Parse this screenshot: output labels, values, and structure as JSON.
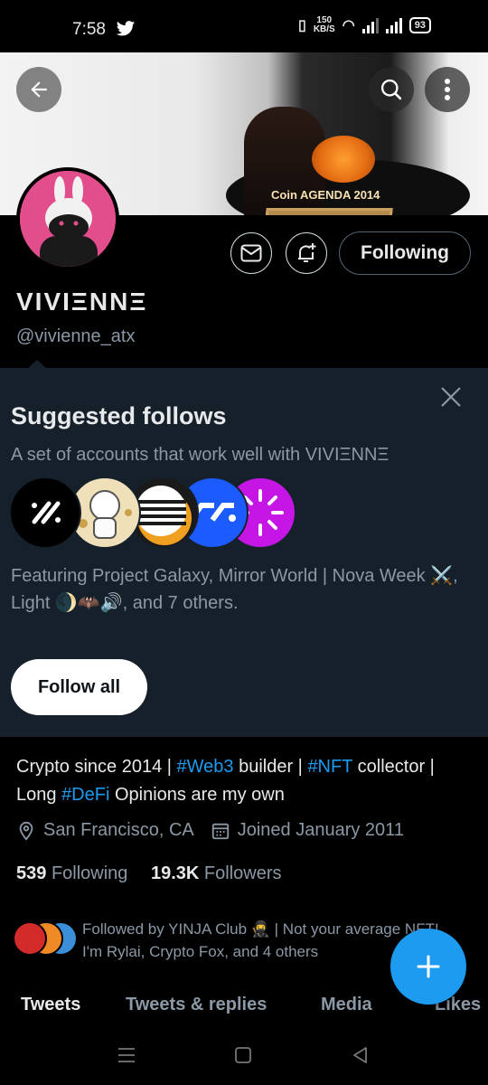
{
  "status_bar": {
    "time": "7:58",
    "net_speed": "150",
    "net_unit": "KB/S",
    "battery": "93"
  },
  "banner": {
    "caption": "Coin AGENDA 2014"
  },
  "profile": {
    "display_name": "VIVIΞNNΞ",
    "handle": "@vivienne_atx",
    "following_button": "Following"
  },
  "suggested": {
    "title": "Suggested follows",
    "subtitle": "A set of accounts that work well with VIVIΞNNΞ",
    "featuring": "Featuring Project Galaxy, Mirror World | Nova Week ⚔️, Light 🌒🦇🔊, and 7 others.",
    "follow_all_label": "Follow all"
  },
  "bio": {
    "part1": "Crypto since 2014 | ",
    "tag1": "#Web3",
    "part2": " builder | ",
    "tag2": "#NFT",
    "part3": " collector | Long ",
    "tag3": "#DeFi",
    "part4": "  Opinions are my own"
  },
  "meta": {
    "location": "San Francisco, CA",
    "joined": "Joined January 2011"
  },
  "counts": {
    "following_num": "539",
    "following_label": "Following",
    "followers_num": "19.3K",
    "followers_label": "Followers"
  },
  "followed_by": "Followed by YINJA Club 🥷 | Not your average NFT!, I'm Rylai, Crypto Fox, and 4 others",
  "tabs": [
    "Tweets",
    "Tweets & replies",
    "Media",
    "Likes"
  ],
  "colors": {
    "accent": "#1d9bf0",
    "panel": "#15202b",
    "muted": "#8b98a5"
  }
}
